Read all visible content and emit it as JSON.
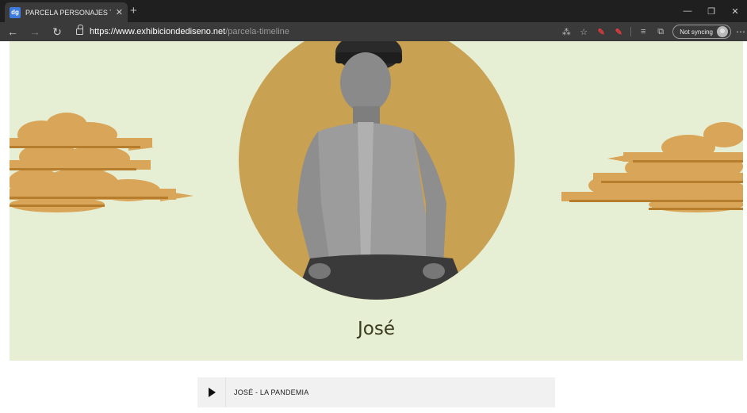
{
  "browser": {
    "tab_title": "PARCELA PERSONAJES TIMELINE",
    "favicon_text": "dg",
    "url_host": "https://www.exhibiciondediseno.net",
    "url_path": "/parcela-timeline",
    "sync_label": "Not syncing",
    "icons": [
      "back-icon",
      "forward-icon",
      "refresh-icon",
      "lock-icon",
      "read-aloud-icon",
      "favorite-star-icon",
      "extension-icon",
      "favorites-icon",
      "collections-icon",
      "profile-icon",
      "more-icon"
    ]
  },
  "hero": {
    "name": "José",
    "colors": {
      "background": "#e6eed4",
      "circle": "#c8a152",
      "cloud_light": "#d8a559",
      "cloud_dark": "#b67d2c"
    }
  },
  "audio": {
    "track_title": "JOSÉ - LA PANDEMIA"
  }
}
